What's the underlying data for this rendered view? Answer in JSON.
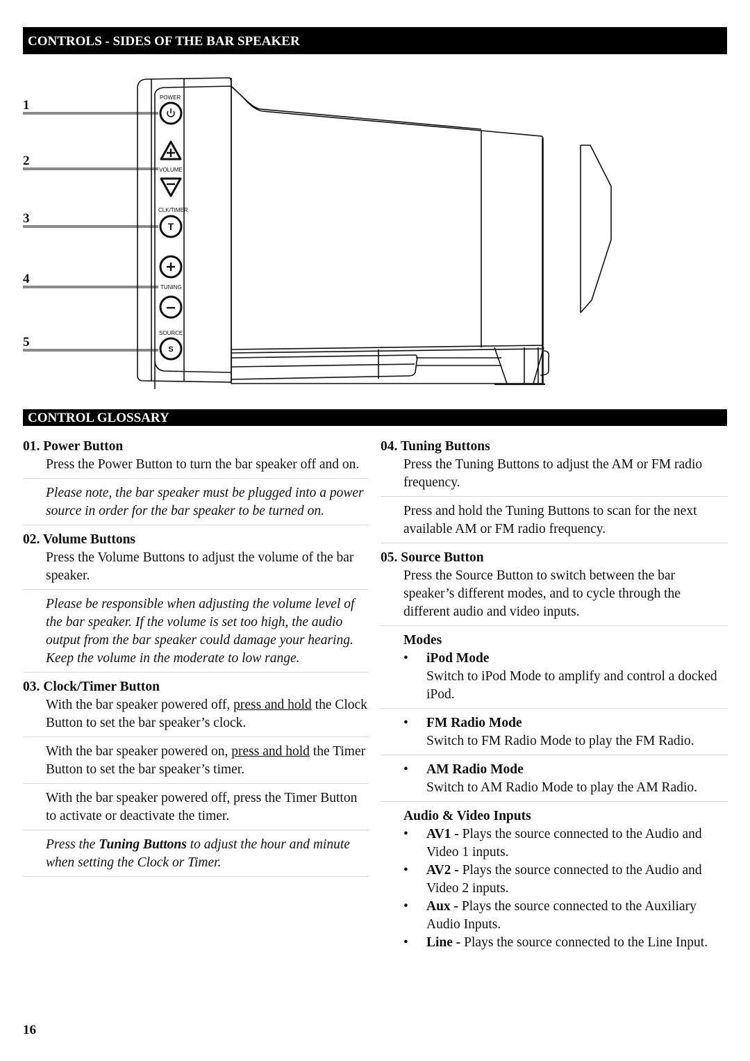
{
  "sections": {
    "controls_title": "CONTROLS - SIDES OF THE BAR SPEAKER",
    "glossary_title": "CONTROL GLOSSARY"
  },
  "callouts": [
    "1",
    "2",
    "3",
    "4",
    "5"
  ],
  "panel_labels": {
    "power": "POWER",
    "volume": "VOLUME",
    "clk_timer": "CLK/TIMER",
    "tuning": "TUNING",
    "source": "SOURCE"
  },
  "panel_buttons": {
    "power_glyph": "power-icon",
    "volume_up_glyph": "plus-triangle-icon",
    "volume_down_glyph": "minus-triangle-icon",
    "timer_glyph": "T",
    "tuning_up_glyph": "plus-icon",
    "tuning_down_glyph": "minus-icon",
    "source_glyph": "S"
  },
  "glossary": {
    "power": {
      "title": "01. Power Button",
      "desc": "Press the Power Button to turn the bar speaker off and on.",
      "note": "Please note, the bar speaker must be plugged into a power source in order for the bar speaker to be turned on."
    },
    "volume": {
      "title": "02. Volume Buttons",
      "desc": "Press the Volume Buttons to adjust the volume of the bar speaker.",
      "note": "Please be responsible when adjusting the volume level of the bar speaker. If the volume is set too high, the audio output from the bar speaker could damage your hearing. Keep the volume in the moderate to low range."
    },
    "clock": {
      "title": "03. Clock/Timer Button",
      "p1_a": "With the bar speaker powered off, ",
      "p1_u": "press and hold",
      "p1_b": " the Clock Button to set the bar speaker’s clock.",
      "p2_a": "With the bar speaker powered on, ",
      "p2_u": "press and hold",
      "p2_b": " the Timer Button to set the bar speaker’s timer.",
      "p3": "With the bar speaker powered off, press the Timer Button to activate or deactivate the timer.",
      "note_a": "Press the ",
      "note_b": "Tuning Buttons",
      "note_c": " to adjust the hour and minute when setting the Clock or Timer."
    },
    "tuning": {
      "title": "04. Tuning Buttons",
      "desc": "Press the Tuning Buttons to adjust the AM or FM radio frequency.",
      "desc2": "Press and hold the Tuning Buttons to scan for the next available AM or FM radio frequency."
    },
    "source": {
      "title": "05. Source Button",
      "desc": "Press the Source Button to switch between the bar speaker’s different modes, and to cycle through the different audio and video inputs.",
      "modes_heading": "Modes",
      "modes": [
        {
          "name": "iPod Mode",
          "desc": "Switch to iPod Mode to amplify and control a docked iPod."
        },
        {
          "name": "FM Radio Mode",
          "desc": "Switch to FM Radio Mode to play the FM Radio."
        },
        {
          "name": "AM Radio Mode",
          "desc": "Switch to AM Radio Mode to play the AM Radio."
        }
      ],
      "inputs_heading": "Audio & Video Inputs",
      "inputs": [
        {
          "name": "AV1 -",
          "desc": " Plays the source connected to the Audio and Video 1 inputs."
        },
        {
          "name": "AV2 -",
          "desc": " Plays the source connected to the Audio and Video 2 inputs."
        },
        {
          "name": "Aux -",
          "desc": " Plays the source connected to the Auxiliary Audio Inputs."
        },
        {
          "name": "Line -",
          "desc": " Plays the source connected to the Line Input."
        }
      ]
    }
  },
  "bullet": "•",
  "page_number": "16"
}
